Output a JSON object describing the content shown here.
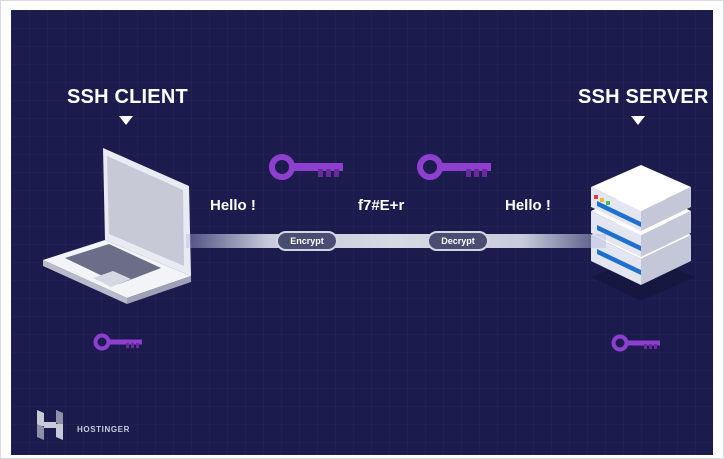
{
  "client": {
    "title": "SSH CLIENT"
  },
  "server": {
    "title": "SSH SERVER"
  },
  "messages": {
    "plain_left": "Hello !",
    "cipher": "f7#E+r",
    "plain_right": "Hello !"
  },
  "steps": {
    "encrypt": "Encrypt",
    "decrypt": "Decrypt"
  },
  "brand": {
    "name": "HOSTINGER"
  },
  "colors": {
    "background": "#1b1c4d",
    "key": "#8e3fcf",
    "key_dark": "#6a2a9e",
    "server_blue": "#1f6fd1",
    "text": "#ffffff"
  },
  "icons": [
    "laptop-icon",
    "server-stack-icon",
    "key-icon",
    "hostinger-logo-icon",
    "arrow-down-icon"
  ]
}
